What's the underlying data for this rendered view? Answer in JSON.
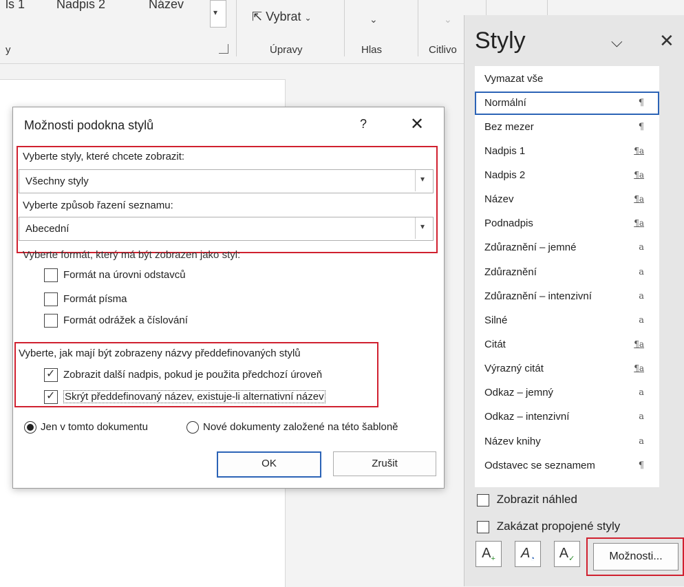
{
  "ribbon": {
    "gallery": [
      "ls 1",
      "Nadpis 2",
      "Název"
    ],
    "label_styly_frag": "y",
    "vybrat_label": "Vybrat",
    "groups": [
      "Úpravy",
      "Hlas",
      "Citlivo"
    ]
  },
  "pane": {
    "title": "Styly",
    "items": [
      {
        "name": "Vymazat vše",
        "icon": ""
      },
      {
        "name": "Normální",
        "icon": "¶"
      },
      {
        "name": "Bez mezer",
        "icon": "¶"
      },
      {
        "name": "Nadpis 1",
        "icon": "¶a"
      },
      {
        "name": "Nadpis 2",
        "icon": "¶a"
      },
      {
        "name": "Název",
        "icon": "¶a"
      },
      {
        "name": "Podnadpis",
        "icon": "¶a"
      },
      {
        "name": "Zdůraznění – jemné",
        "icon": "a"
      },
      {
        "name": "Zdůraznění",
        "icon": "a"
      },
      {
        "name": "Zdůraznění – intenzivní",
        "icon": "a"
      },
      {
        "name": "Silné",
        "icon": "a"
      },
      {
        "name": "Citát",
        "icon": "¶a"
      },
      {
        "name": "Výrazný citát",
        "icon": "¶a"
      },
      {
        "name": "Odkaz – jemný",
        "icon": "a"
      },
      {
        "name": "Odkaz – intenzivní",
        "icon": "a"
      },
      {
        "name": "Název knihy",
        "icon": "a"
      },
      {
        "name": "Odstavec se seznamem",
        "icon": "¶"
      }
    ],
    "selected_index": 1,
    "show_preview": "Zobrazit náhled",
    "disable_linked": "Zakázat propojené styly",
    "options_button": "Možnosti..."
  },
  "dialog": {
    "title": "Možnosti podokna stylů",
    "help": "?",
    "select_styles_label": "Vyberte styly, které chcete zobrazit:",
    "select_styles_value": "Všechny styly",
    "sort_label": "Vyberte způsob řazení seznamu:",
    "sort_value": "Abecední",
    "format_label": "Vyberte formát, který má být zobrazen jako styl:",
    "format_options": [
      {
        "label": "Formát na úrovni odstavců",
        "checked": false
      },
      {
        "label": "Formát písma",
        "checked": false
      },
      {
        "label": "Formát odrážek a číslování",
        "checked": false
      }
    ],
    "names_label": "Vyberte, jak mají být zobrazeny názvy předdefinovaných stylů",
    "names_options": [
      {
        "label": "Zobrazit další nadpis, pokud je použita předchozí úroveň",
        "checked": true
      },
      {
        "label": "Skrýt předdefinovaný název, existuje-li alternativní název",
        "checked": true
      }
    ],
    "radio_this_doc": "Jen v tomto dokumentu",
    "radio_template": "Nové dokumenty založené na této šabloně",
    "radio_selected": "this_doc",
    "ok": "OK",
    "cancel": "Zrušit"
  },
  "colors": {
    "highlight_red": "#d0202f",
    "accent_blue": "#2b63b6"
  }
}
